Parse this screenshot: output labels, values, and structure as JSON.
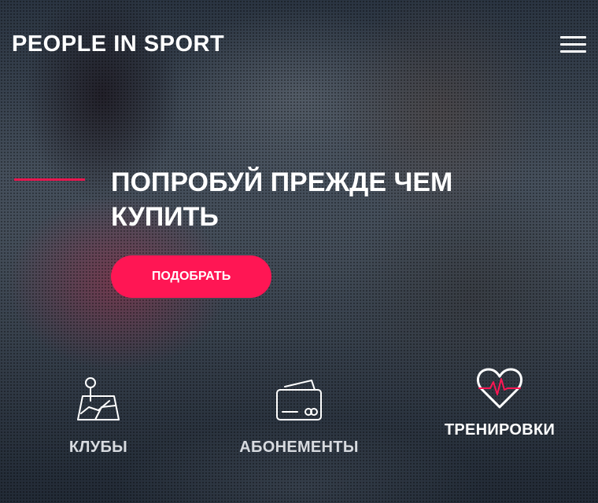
{
  "header": {
    "brand": "PEOPLE IN SPORT",
    "menu_icon": "hamburger-menu-icon"
  },
  "hero": {
    "headline": "ПОПРОБУЙ ПРЕЖДЕ ЧЕМ КУПИТЬ",
    "cta_label": "ПОДОБРАТЬ"
  },
  "features": [
    {
      "label": "КЛУБЫ",
      "icon": "map-pin-icon"
    },
    {
      "label": "АБОНЕМЕНТЫ",
      "icon": "membership-card-icon"
    },
    {
      "label": "ТРЕНИРОВКИ",
      "icon": "heart-pulse-icon",
      "active": true
    }
  ],
  "colors": {
    "accent": "#ff1654",
    "accent_line": "#e8174f",
    "text": "#ffffff",
    "muted_text": "#d8dbe0"
  }
}
